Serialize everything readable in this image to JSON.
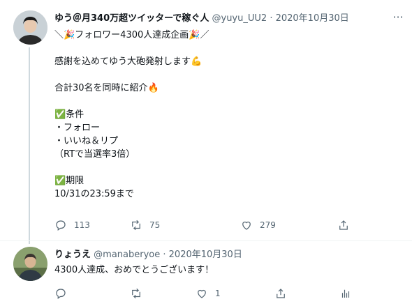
{
  "tweet1": {
    "display_name": "ゆう＠月340万超ツイッターで稼ぐ人",
    "handle": "@yuyu_UU2",
    "separator": "·",
    "date": "2020年10月30日",
    "more": "···",
    "text": "＼🎉フォロワー4300人達成企画🎉／\n\n感謝を込めてゆう大砲発射します💪\n\n合計30名を同時に紹介🔥\n\n✅条件\n・フォロー\n・いいね＆リプ\n（RTで当選率3倍）\n\n✅期限\n10/31の23:59まで",
    "reply_count": "113",
    "retweet_count": "75",
    "like_count": "279",
    "share_count": ""
  },
  "tweet2": {
    "display_name": "りょうえ",
    "handle": "@manaberyoe",
    "separator": "·",
    "date": "2020年10月30日",
    "text": "4300人達成、おめでとうございます！",
    "reply_count": "",
    "retweet_count": "",
    "like_count": "1",
    "share_count": ""
  },
  "icons": {
    "reply": "reply-icon",
    "retweet": "retweet-icon",
    "like": "heart-icon",
    "share": "share-icon",
    "analytics": "analytics-icon"
  },
  "colors": {
    "text": "#0f1419",
    "secondary": "#536471",
    "thread_line": "#cfd9de"
  }
}
